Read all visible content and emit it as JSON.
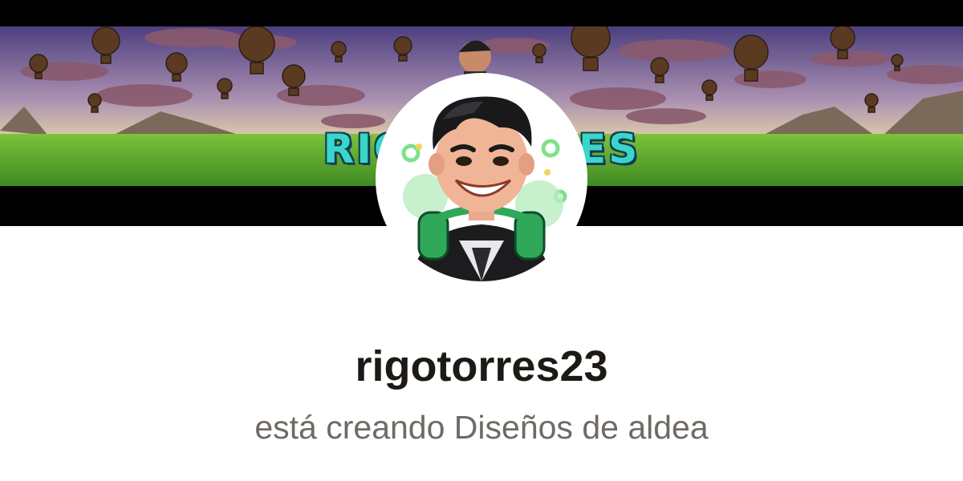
{
  "profile": {
    "username": "rigotorres23",
    "tagline": "está creando Diseños de aldea",
    "banner_text": "RIGOTORRES"
  },
  "icons": {
    "avatar": "cartoon-avatar-with-headphones",
    "banner_balloons": "hot-air-balloon-icon"
  },
  "colors": {
    "banner_sky_top": "#5a4a8a",
    "banner_sky_bottom": "#f5e6a8",
    "banner_grass": "#5aa72c",
    "banner_title": "#3ad6c8",
    "name_text": "#1d1a16",
    "tagline_text": "#6f6a64"
  }
}
